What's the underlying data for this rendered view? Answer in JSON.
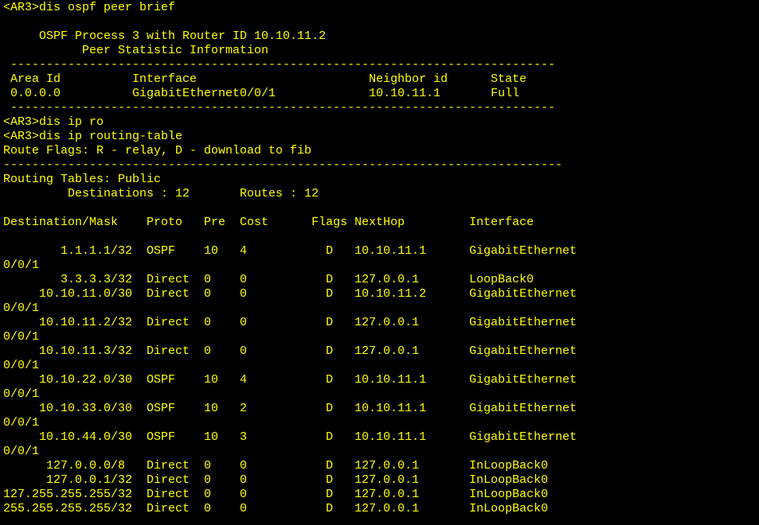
{
  "colors": {
    "background": "#000000",
    "text": "#ffff00"
  },
  "terminal": {
    "lines": [
      "<AR3>dis ospf peer brief",
      "",
      "     OSPF Process 3 with Router ID 10.10.11.2",
      "           Peer Statistic Information",
      " ----------------------------------------------------------------------------",
      " Area Id          Interface                        Neighbor id      State",
      " 0.0.0.0          GigabitEthernet0/0/1             10.10.11.1       Full",
      " ----------------------------------------------------------------------------",
      "<AR3>dis ip ro",
      "<AR3>dis ip routing-table",
      "Route Flags: R - relay, D - download to fib",
      "------------------------------------------------------------------------------",
      "Routing Tables: Public",
      "         Destinations : 12       Routes : 12",
      "",
      "Destination/Mask    Proto   Pre  Cost      Flags NextHop         Interface",
      "",
      "        1.1.1.1/32  OSPF    10   4           D   10.10.11.1      GigabitEthernet",
      "0/0/1",
      "        3.3.3.3/32  Direct  0    0           D   127.0.0.1       LoopBack0",
      "     10.10.11.0/30  Direct  0    0           D   10.10.11.2      GigabitEthernet",
      "0/0/1",
      "     10.10.11.2/32  Direct  0    0           D   127.0.0.1       GigabitEthernet",
      "0/0/1",
      "     10.10.11.3/32  Direct  0    0           D   127.0.0.1       GigabitEthernet",
      "0/0/1",
      "     10.10.22.0/30  OSPF    10   4           D   10.10.11.1      GigabitEthernet",
      "0/0/1",
      "     10.10.33.0/30  OSPF    10   2           D   10.10.11.1      GigabitEthernet",
      "0/0/1",
      "     10.10.44.0/30  OSPF    10   3           D   10.10.11.1      GigabitEthernet",
      "0/0/1",
      "      127.0.0.0/8   Direct  0    0           D   127.0.0.1       InLoopBack0",
      "      127.0.0.1/32  Direct  0    0           D   127.0.0.1       InLoopBack0",
      "127.255.255.255/32  Direct  0    0           D   127.0.0.1       InLoopBack0",
      "255.255.255.255/32  Direct  0    0           D   127.0.0.1       InLoopBack0"
    ]
  }
}
